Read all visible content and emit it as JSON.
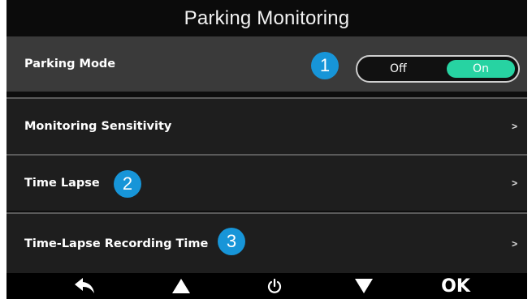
{
  "header": {
    "title": "Parking Monitoring"
  },
  "rows": [
    {
      "label": "Parking Mode",
      "badge": "1",
      "selected": true
    },
    {
      "label": "Monitoring Sensitivity",
      "chevron": ">"
    },
    {
      "label": "Time Lapse",
      "badge": "2",
      "chevron": ">"
    },
    {
      "label": "Time-Lapse Recording Time",
      "badge": "3",
      "chevron": ">"
    }
  ],
  "parking_toggle": {
    "off_label": "Off",
    "on_label": "On",
    "state": "On"
  },
  "footer": {
    "buttons": [
      {
        "icon": "back-arrow-icon"
      },
      {
        "icon": "up-triangle-icon"
      },
      {
        "icon": "power-icon"
      },
      {
        "icon": "down-triangle-icon"
      },
      {
        "label": "OK"
      }
    ]
  },
  "colors": {
    "badge": "#1795d8",
    "toggle_on": "#27d3a2",
    "selected_row": "#3a3a3a",
    "row": "#1e1e1e"
  }
}
